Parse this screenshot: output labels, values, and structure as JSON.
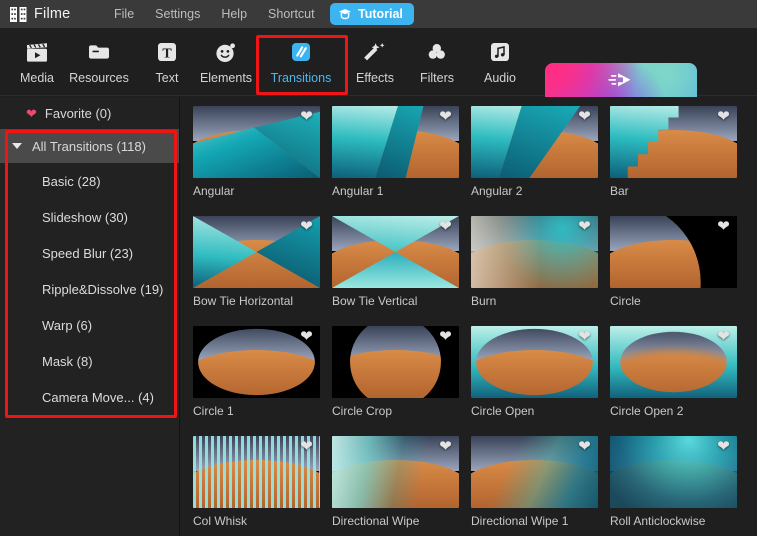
{
  "app": {
    "brand": "Filme",
    "brand_icon": "film-strip-icon"
  },
  "menu": {
    "items": [
      {
        "label": "File"
      },
      {
        "label": "Settings"
      },
      {
        "label": "Help"
      },
      {
        "label": "Shortcut"
      }
    ],
    "tutorial": {
      "label": "Tutorial",
      "icon": "graduation-cap-icon",
      "color": "#3cb4f0"
    }
  },
  "toolbar": {
    "items": [
      {
        "label": "Media",
        "icon": "clapperboard-icon",
        "active": false
      },
      {
        "label": "Resources",
        "icon": "folder-icon",
        "active": false
      },
      {
        "label": "Text",
        "icon": "text-t-icon",
        "active": false
      },
      {
        "label": "Elements",
        "icon": "smiley-icon",
        "active": false
      },
      {
        "label": "Transitions",
        "icon": "transitions-icon",
        "active": true
      },
      {
        "label": "Effects",
        "icon": "magic-wand-icon",
        "active": false
      },
      {
        "label": "Filters",
        "icon": "color-circles-icon",
        "active": false
      },
      {
        "label": "Audio",
        "icon": "music-note-icon",
        "active": false
      }
    ],
    "fast_video": {
      "label": "Fast Video",
      "icon": "fast-forward-icon"
    },
    "active_label_color": "#4db7ee"
  },
  "highlights": {
    "color": "#f11414",
    "regions": [
      "transitions-tab",
      "transition-categories-list"
    ]
  },
  "sidebar": {
    "favorite": {
      "label": "Favorite (0)",
      "icon": "heart-icon",
      "icon_color": "#f0476a"
    },
    "all": {
      "label": "All Transitions (118)",
      "icon": "caret-down-icon",
      "selected": true
    },
    "categories": [
      {
        "label": "Basic (28)"
      },
      {
        "label": "Slideshow (30)"
      },
      {
        "label": "Speed Blur (23)"
      },
      {
        "label": "Ripple&Dissolve (19)"
      },
      {
        "label": "Warp (6)"
      },
      {
        "label": "Mask (8)"
      },
      {
        "label": "Camera Move... (4)"
      }
    ]
  },
  "grid": {
    "favorite_icon": "heart-icon",
    "items": [
      {
        "label": "Angular",
        "style": "angular"
      },
      {
        "label": "Angular 1",
        "style": "angular1"
      },
      {
        "label": "Angular 2",
        "style": "angular2"
      },
      {
        "label": "Bar",
        "style": "bar"
      },
      {
        "label": "Bow Tie Horizontal",
        "style": "bowtie-h"
      },
      {
        "label": "Bow Tie Vertical",
        "style": "bowtie-v"
      },
      {
        "label": "Burn",
        "style": "burn"
      },
      {
        "label": "Circle",
        "style": "circle"
      },
      {
        "label": "Circle 1",
        "style": "circle1"
      },
      {
        "label": "Circle Crop",
        "style": "circle-crop"
      },
      {
        "label": "Circle Open",
        "style": "circle-open"
      },
      {
        "label": "Circle Open 2",
        "style": "circle-open2"
      },
      {
        "label": "Col Whisk",
        "style": "col-whisk"
      },
      {
        "label": "Directional Wipe",
        "style": "dir-wipe"
      },
      {
        "label": "Directional Wipe 1",
        "style": "dir-wipe1"
      },
      {
        "label": "Roll Anticlockwise",
        "style": "roll-anti"
      }
    ]
  }
}
